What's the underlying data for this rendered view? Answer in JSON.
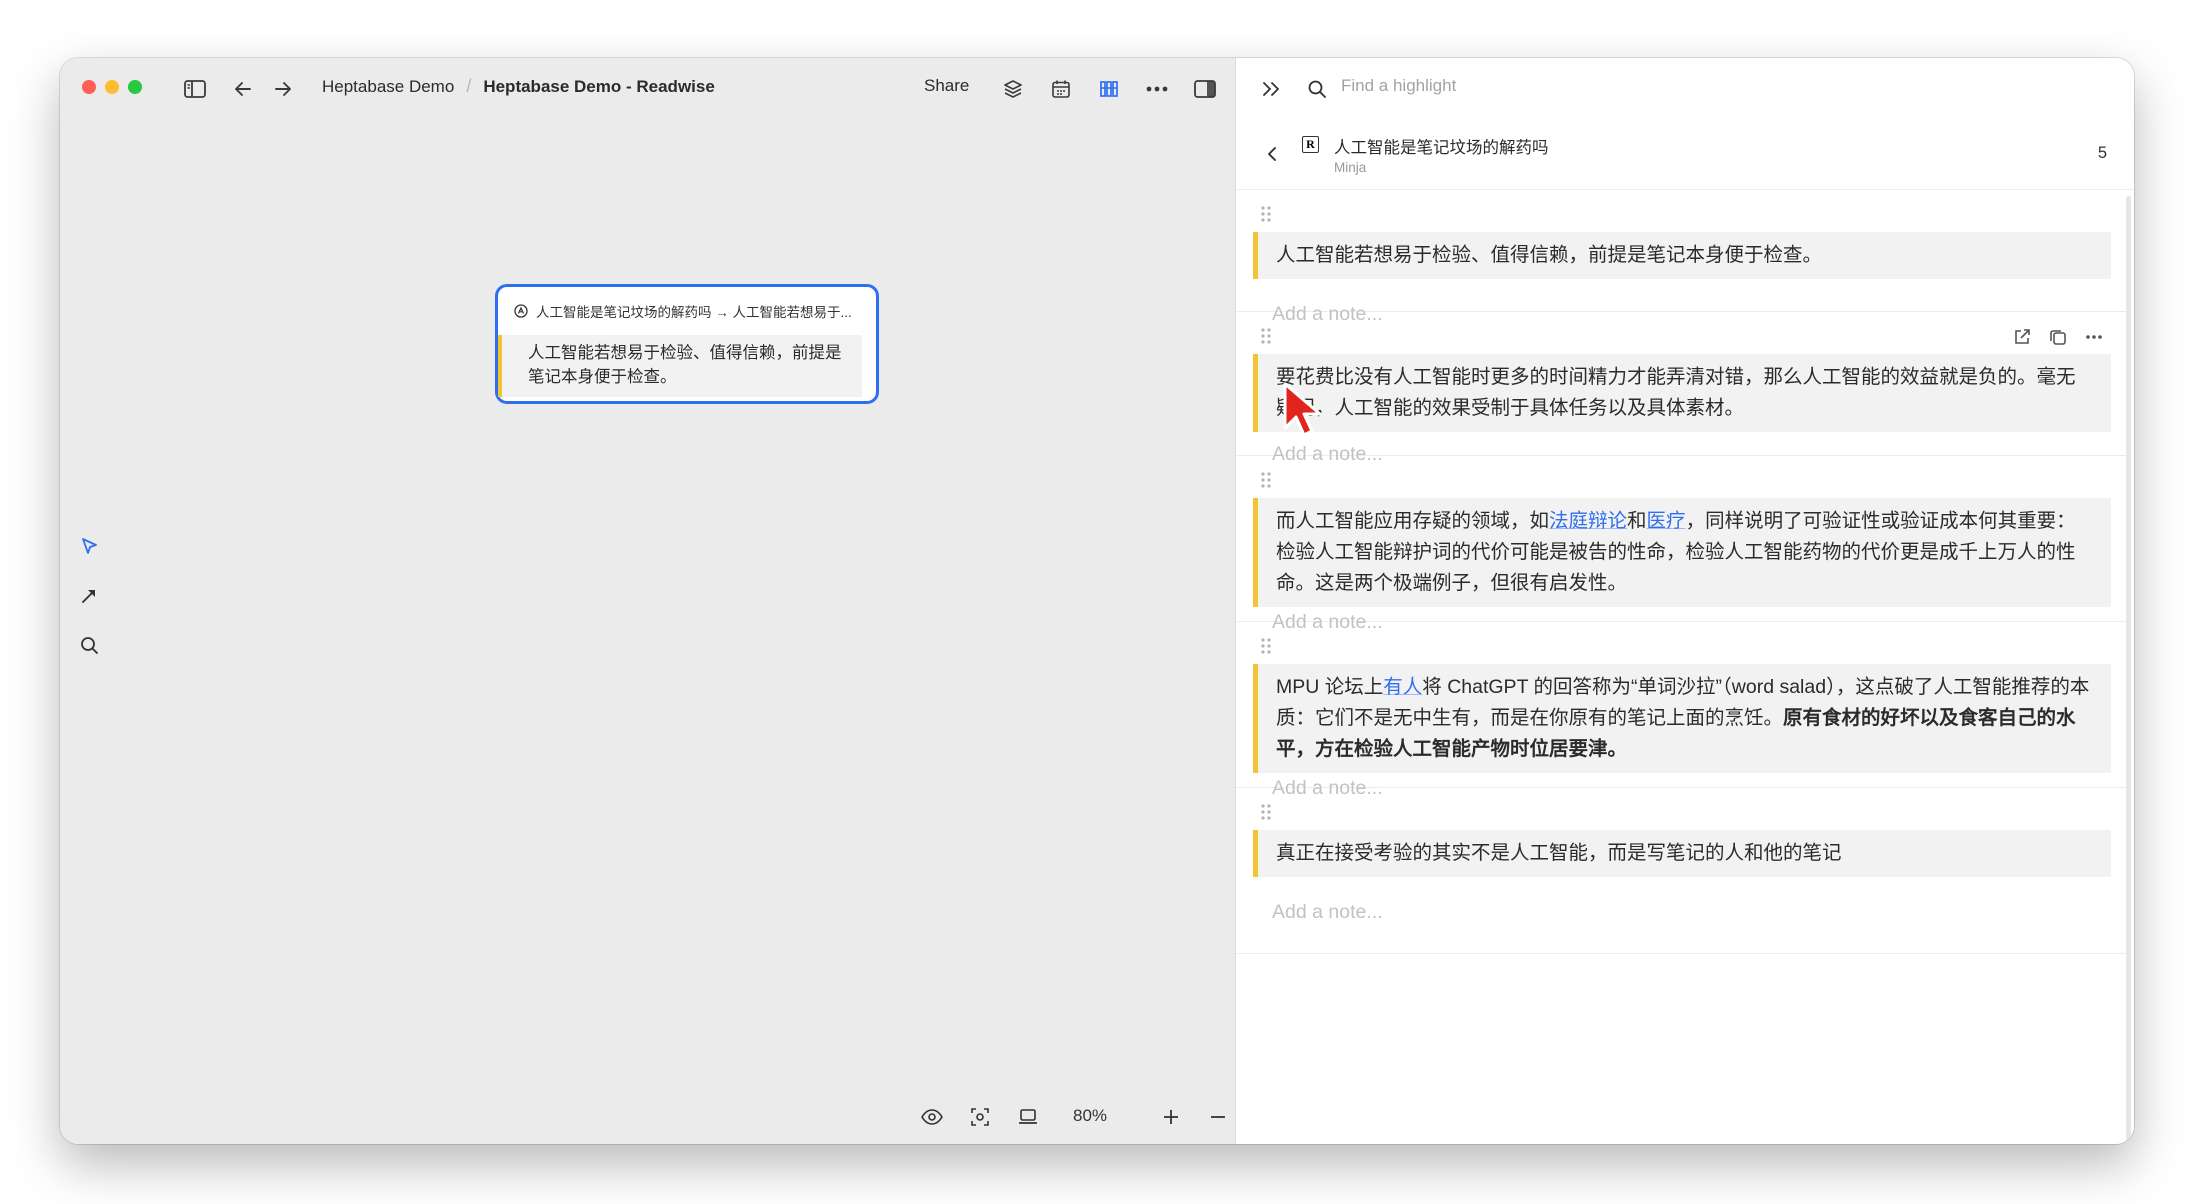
{
  "breadcrumb": {
    "parent": "Heptabase Demo",
    "current": "Heptabase Demo - Readwise"
  },
  "toolbar": {
    "share_label": "Share"
  },
  "canvas_card": {
    "header": "人工智能是笔记坟场的解药吗 → 人工智能若想易于...",
    "body": "人工智能若想易于检验、值得信赖，前提是笔记本身便于检查。"
  },
  "bottom": {
    "zoom": "80%"
  },
  "panel": {
    "search_placeholder": "Find a highlight",
    "doc_title": "人工智能是笔记坟场的解药吗",
    "doc_author": "Minja",
    "doc_count": "5",
    "note_placeholder": "Add a note...",
    "highlights": [
      {
        "segments": [
          {
            "t": "人工智能若想易于检验、值得信赖，前提是笔记本身便于检查。"
          }
        ]
      },
      {
        "segments": [
          {
            "t": "要花费比没有人工智能时更多的时间精力才能弄清对错，那么人工智能的效益就是负的。毫无疑问，人工智能的效果受制于具体任务以及具体素材。"
          }
        ]
      },
      {
        "segments": [
          {
            "t": "而人工智能应用存疑的领域，如"
          },
          {
            "t": "法庭辩论",
            "link": true
          },
          {
            "t": "和"
          },
          {
            "t": "医疗",
            "link": true
          },
          {
            "t": "，同样说明了可验证性或验证成本何其重要：检验人工智能辩护词的代价可能是被告的性命，检验人工智能药物的代价更是成千上万人的性命。这是两个极端例子，但很有启发性。"
          }
        ]
      },
      {
        "segments": [
          {
            "t": "MPU 论坛上"
          },
          {
            "t": "有人",
            "link": true
          },
          {
            "t": "将 ChatGPT 的回答称为“单词沙拉”（word salad），这点破了人工智能推荐的本质：它们不是无中生有，而是在你原有的笔记上面的烹饪。"
          },
          {
            "t": "原有食材的好坏以及食客自己的水平，方在检验人工智能产物时位居要津。",
            "bold": true
          }
        ]
      },
      {
        "segments": [
          {
            "t": "真正在接受考验的其实不是人工智能，而是写笔记的人和他的笔记"
          }
        ]
      }
    ]
  },
  "colors": {
    "accent": "#2e6ff2",
    "highlight_bar": "#f2c335"
  }
}
